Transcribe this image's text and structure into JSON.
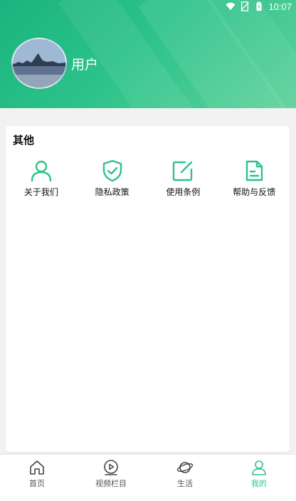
{
  "status_bar": {
    "time": "10:07"
  },
  "profile": {
    "username": "用户"
  },
  "section": {
    "title": "其他",
    "items": [
      {
        "label": "关于我们",
        "icon": "person-icon"
      },
      {
        "label": "隐私政策",
        "icon": "shield-check-icon"
      },
      {
        "label": "使用条例",
        "icon": "edit-icon"
      },
      {
        "label": "帮助与反馈",
        "icon": "document-icon"
      }
    ]
  },
  "tabs": [
    {
      "label": "首页",
      "icon": "home-icon",
      "active": false
    },
    {
      "label": "视频栏目",
      "icon": "play-icon",
      "active": false
    },
    {
      "label": "生活",
      "icon": "planet-icon",
      "active": false
    },
    {
      "label": "我的",
      "icon": "user-icon",
      "active": true
    }
  ],
  "colors": {
    "accent": "#2fc28b",
    "header_start": "#1bb37f",
    "header_end": "#5fd29b"
  }
}
